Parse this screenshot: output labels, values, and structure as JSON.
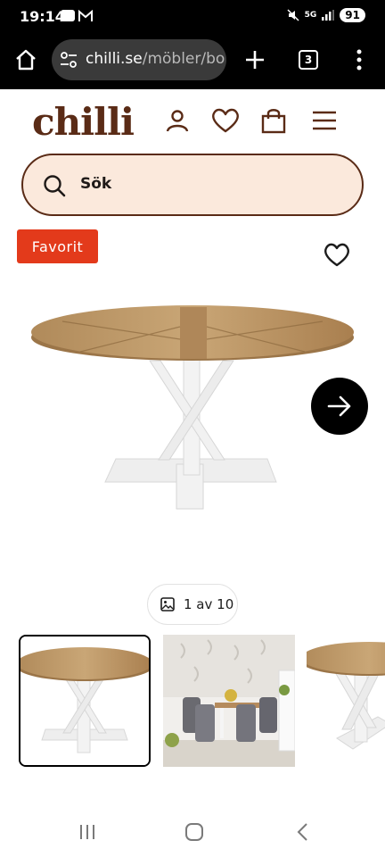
{
  "status_bar": {
    "time": "19:14",
    "network_label": "5G",
    "battery": "91"
  },
  "browser": {
    "url_host": "chilli.se",
    "url_path": "/möbler/bo",
    "tab_count": "3",
    "icons": [
      "home-icon",
      "site-settings-icon",
      "plus-icon",
      "tabs-icon",
      "more-icon"
    ]
  },
  "site": {
    "logo": "chilli",
    "header_icons": [
      "account-icon",
      "heart-icon",
      "cart-icon",
      "menu-icon"
    ],
    "brand_color": "#5a2b16"
  },
  "search": {
    "placeholder": "Sök"
  },
  "product": {
    "badge": "Favorit",
    "badge_color": "#e33a1b",
    "image_counter": "1 av 10"
  },
  "gallery": {
    "current": 1,
    "total": 10,
    "thumbnails": [
      "table-thumbnail",
      "dining-room-thumbnail",
      "table-angle-thumbnail"
    ]
  }
}
